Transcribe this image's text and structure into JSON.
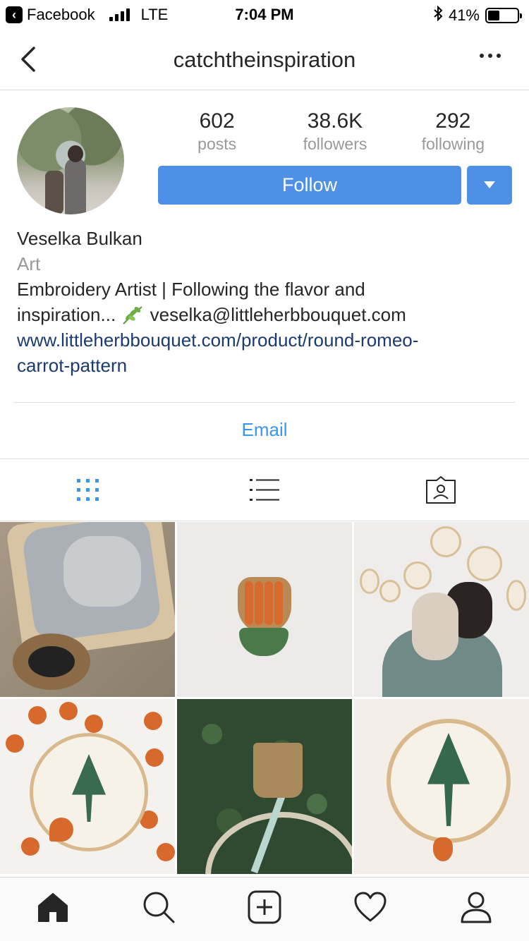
{
  "status_bar": {
    "back_app": "Facebook",
    "network": "LTE",
    "time": "7:04 PM",
    "battery": "41%",
    "battery_level": 0.41
  },
  "nav": {
    "title": "catchtheinspiration",
    "back_icon": "chevron-left-icon",
    "more_icon": "more-horizontal-icon"
  },
  "profile": {
    "stats": [
      {
        "value": "602",
        "label": "posts"
      },
      {
        "value": "38.6K",
        "label": "followers"
      },
      {
        "value": "292",
        "label": "following"
      }
    ],
    "follow_label": "Follow",
    "name": "Veselka Bulkan",
    "category": "Art",
    "bio_line1": "Embroidery Artist | Following the flavor and",
    "bio_line2": "inspiration... ",
    "bio_email": "veselka@littleherbbouquet.com",
    "link_line1": "www.littleherbbouquet.com/product/round-romeo-",
    "link_line2": "carrot-pattern",
    "email_button": "Email"
  },
  "view_tabs": [
    "grid-icon",
    "list-icon",
    "tagged-icon"
  ],
  "bottom_tabs": [
    "home-icon",
    "search-icon",
    "add-post-icon",
    "heart-icon",
    "profile-icon"
  ],
  "colors": {
    "accent_blue": "#4d90e6",
    "link_blue": "#3897f0",
    "link_dark": "#1b3b6f",
    "muted": "#999999"
  }
}
